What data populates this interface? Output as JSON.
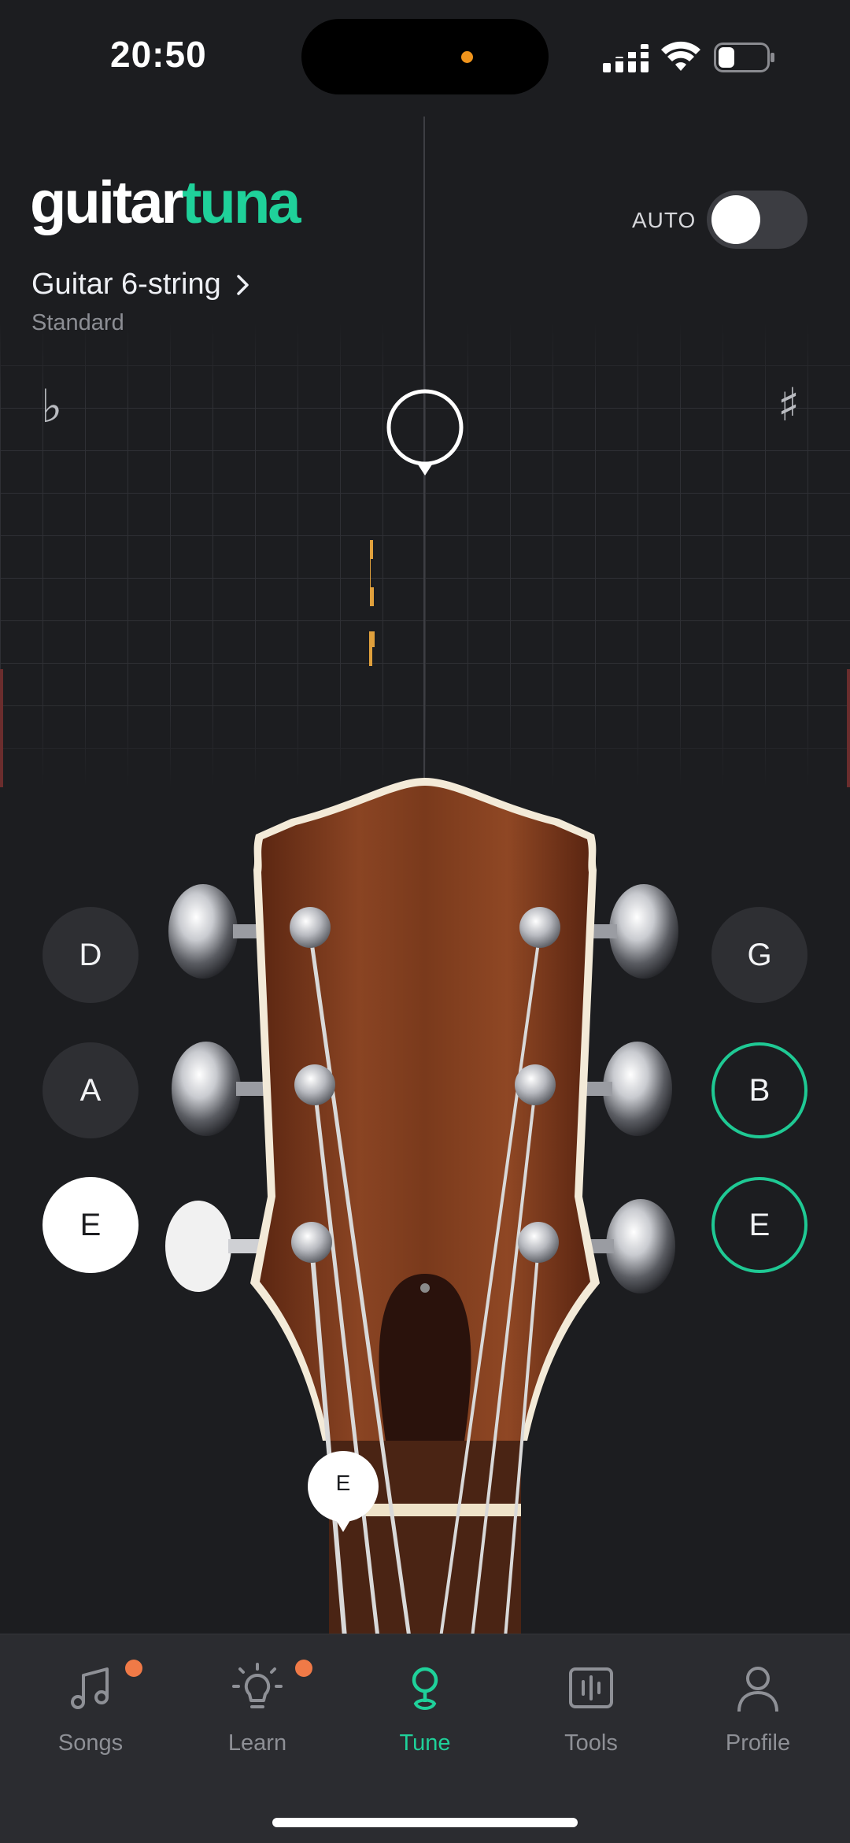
{
  "status_bar": {
    "time": "20:50"
  },
  "header": {
    "logo_part1": "guitar",
    "logo_part2": "tuna",
    "instrument": "Guitar 6-string",
    "tuning": "Standard",
    "auto_label": "AUTO",
    "auto_enabled": false
  },
  "tuner": {
    "flat_symbol": "♭",
    "sharp_symbol": "♯"
  },
  "pegs": {
    "left": [
      {
        "note": "D",
        "state": "default"
      },
      {
        "note": "A",
        "state": "default"
      },
      {
        "note": "E",
        "state": "selected"
      }
    ],
    "right": [
      {
        "note": "G",
        "state": "default"
      },
      {
        "note": "B",
        "state": "tuned"
      },
      {
        "note": "E",
        "state": "tuned"
      }
    ]
  },
  "current_string_label": "E",
  "nav": {
    "items": [
      {
        "label": "Songs",
        "icon": "music-note-icon",
        "badge": true
      },
      {
        "label": "Learn",
        "icon": "lightbulb-icon",
        "badge": true
      },
      {
        "label": "Tune",
        "icon": "tuning-fork-icon",
        "active": true
      },
      {
        "label": "Tools",
        "icon": "tools-icon"
      },
      {
        "label": "Profile",
        "icon": "profile-icon"
      }
    ]
  },
  "colors": {
    "background": "#1c1d20",
    "accent": "#1fd19a",
    "badge": "#f07a47",
    "pitch_indicator": "#e0a03c",
    "wood": "#7a3a1c"
  }
}
